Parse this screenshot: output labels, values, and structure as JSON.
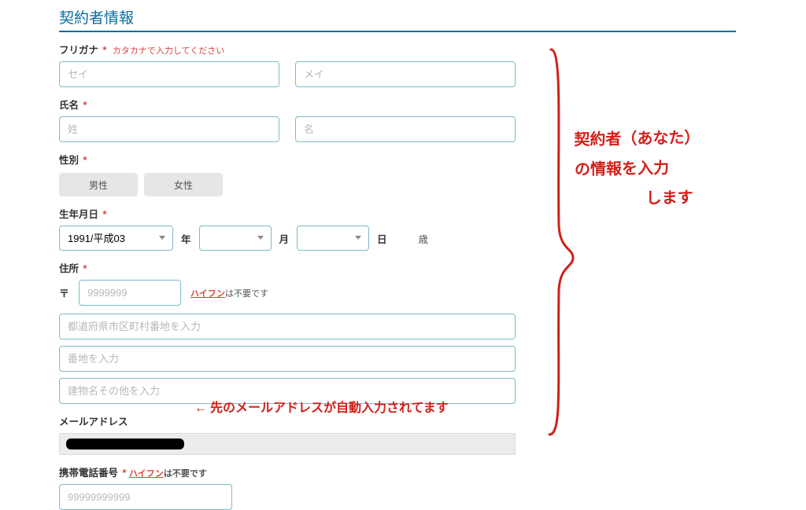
{
  "section_title": "契約者情報",
  "furigana": {
    "label": "フリガナ",
    "hint": "カタカナで入力してください",
    "sei_ph": "セイ",
    "mei_ph": "メイ"
  },
  "name": {
    "label": "氏名",
    "sei_ph": "姓",
    "mei_ph": "名"
  },
  "gender": {
    "label": "性別",
    "male": "男性",
    "female": "女性"
  },
  "dob": {
    "label": "生年月日",
    "year_value": "1991/平成03",
    "year_unit": "年",
    "month_unit": "月",
    "day_unit": "日",
    "age_unit": "歳"
  },
  "address": {
    "label": "住所",
    "post_mark": "〒",
    "postal_ph": "9999999",
    "hyphen_link": "ハイフン",
    "hyphen_rest": "は不要です",
    "line1_ph": "都道府県市区町村番地を入力",
    "line2_ph": "番地を入力",
    "line3_ph": "建物名その他を入力"
  },
  "email": {
    "label": "メールアドレス"
  },
  "phone": {
    "label": "携帯電話番号",
    "hyphen_link": "ハイフン",
    "hyphen_rest": "は不要です",
    "ph": "99999999999"
  },
  "annotations": {
    "side_l1": "契約者（あなた）",
    "side_l2": "の情報を入力",
    "side_l3": "します",
    "email_note": "← 先のメールアドレスが自動入力されてます"
  },
  "req_mark": "*"
}
